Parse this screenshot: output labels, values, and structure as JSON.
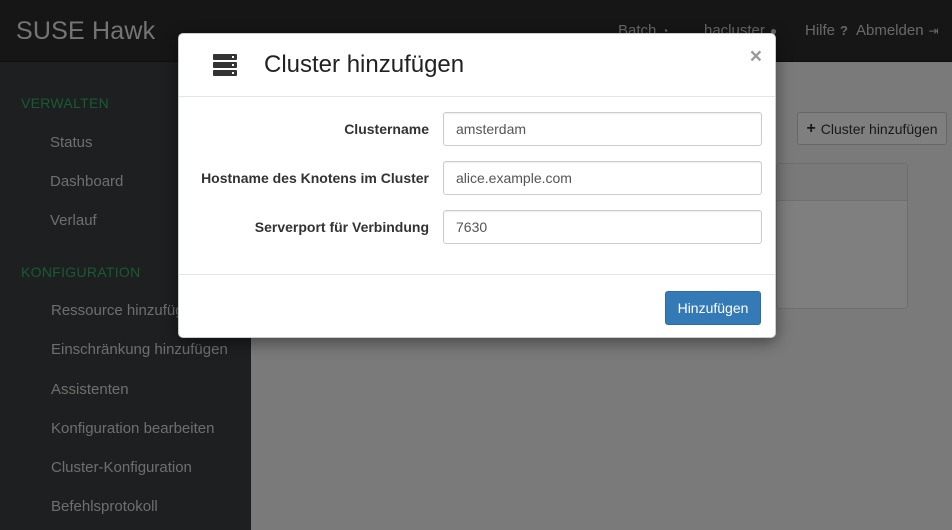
{
  "app": {
    "brand": "SUSE Hawk"
  },
  "topnav": {
    "batch": "Batch",
    "cluster_name": "hacluster",
    "help": "Hilfe",
    "logout": "Abmelden"
  },
  "sidebar": {
    "manage_title": "VERWALTEN",
    "manage_items": [
      {
        "label": "Status"
      },
      {
        "label": "Dashboard"
      },
      {
        "label": "Verlauf"
      }
    ],
    "config_title": "KONFIGURATION",
    "config_items": [
      {
        "label": "Ressource hinzufügen"
      },
      {
        "label": "Einschränkung hinzufügen"
      },
      {
        "label": "Assistenten"
      },
      {
        "label": "Konfiguration bearbeiten"
      },
      {
        "label": "Cluster-Konfiguration"
      },
      {
        "label": "Befehlsprotokoll"
      }
    ]
  },
  "main": {
    "add_cluster_label": "Cluster hinzufügen"
  },
  "modal": {
    "title": "Cluster hinzufügen",
    "close_glyph": "×",
    "fields": [
      {
        "label": "Clustername",
        "value": "amsterdam"
      },
      {
        "label": "Hostname des Knotens im Cluster",
        "value": "alice.example.com"
      },
      {
        "label": "Serverport für Verbindung",
        "value": "7630"
      }
    ],
    "submit_label": "Hinzufügen"
  },
  "icons": {
    "modal_header": "server-icon",
    "add": "plus-icon",
    "user": "user-icon",
    "help": "question-icon",
    "logout": "sign-out-icon",
    "batch": "batch-icon"
  },
  "colors": {
    "accent_green": "#30b565",
    "primary_button": "#337ab7",
    "sidebar_bg": "#3b3f41",
    "topbar_bg": "#2d2d2d"
  }
}
